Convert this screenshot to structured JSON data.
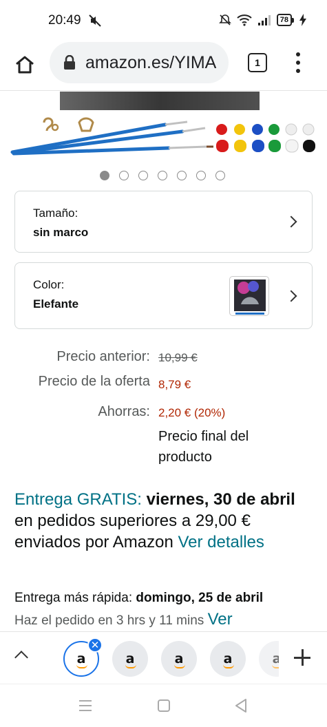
{
  "status_bar": {
    "time": "20:49",
    "battery": "78"
  },
  "browser": {
    "url": "amazon.es/YIMA",
    "tab_count": "1"
  },
  "carousel": {
    "total": 7,
    "active": 0
  },
  "variations": {
    "size": {
      "label": "Tamaño:",
      "value": "sin marco"
    },
    "color": {
      "label": "Color:",
      "value": "Elefante"
    }
  },
  "price": {
    "previous_label": "Precio anterior:",
    "previous_value": "10,99 €",
    "offer_label": "Precio de la oferta",
    "offer_value": "8,79 €",
    "savings_label": "Ahorras:",
    "savings_value": "2,20 € (20%)",
    "final_note": "Precio final del producto"
  },
  "delivery": {
    "free_label": "Entrega GRATIS:",
    "date": "viernes, 30 de abril",
    "condition": "en pedidos superiores a 29,00 € enviados por Amazon",
    "details_link": "Ver detalles"
  },
  "fast_delivery": {
    "label": "Entrega más rápida:",
    "date": "domingo, 25 de abril",
    "order_within": "Haz el pedido en 3 hrs y 11 mins",
    "details_link": "Ver"
  },
  "tab_strip": {
    "tab_letter": "a"
  },
  "colors": {
    "teal": "#007185",
    "price_red": "#b12704",
    "accent_blue": "#1a73e8",
    "amazon_orange": "#ff9900"
  }
}
